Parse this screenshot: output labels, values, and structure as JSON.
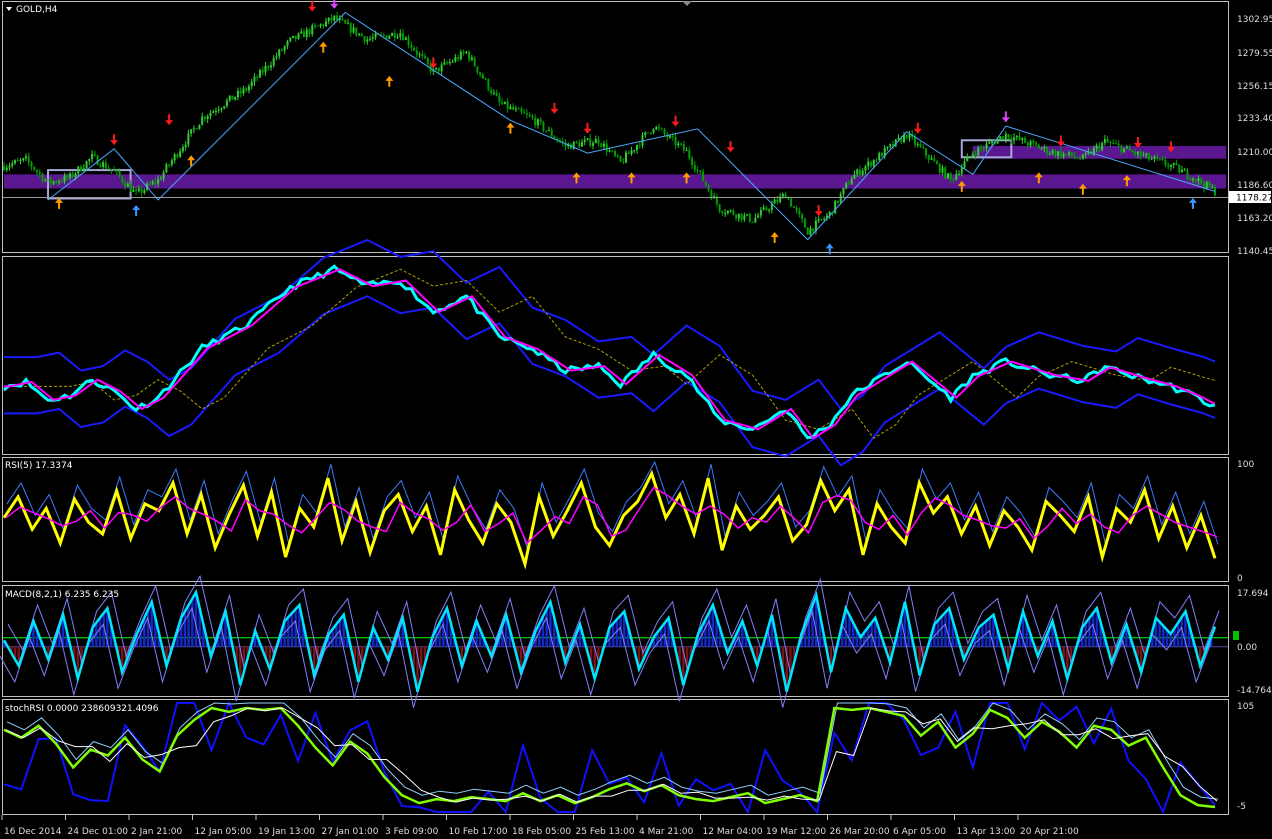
{
  "window": {
    "symbol_title": "GOLD,H4",
    "current_price": "1178.27"
  },
  "colors": {
    "background": "#000000",
    "frame": "#c0c0c0",
    "candle_up": "#32cd32",
    "candle_down": "#00a000",
    "zigzag": "#4aa8ff",
    "zone": "#5b178f",
    "arrow_down": "#ff1a1a",
    "arrow_up": "#ff9a00",
    "arrow_top": "#e040fb",
    "arrow_bottom": "#3399ff",
    "bollinger": "#1a1aff",
    "ma_fast": "#00ffff",
    "ma_mid": "#ff00ff",
    "rsi_main": "#ffff00",
    "rsi_signal": "#ff00ff",
    "macd_line": "#00e5ff",
    "macd_hist_pos": "#1428c8",
    "macd_hist_neg": "#7a1515",
    "stoch_fast": "#7fff00",
    "stoch_raw": "#1010ff",
    "level_line": "#00ff00"
  },
  "x_axis": {
    "labels": [
      "16 Dec 2014",
      "24 Dec 01:00",
      "2 Jan 21:00",
      "12 Jan 05:00",
      "19 Jan 13:00",
      "27 Jan 01:00",
      "3 Feb 09:00",
      "10 Feb 17:00",
      "18 Feb 05:00",
      "25 Feb 13:00",
      "4 Mar 21:00",
      "12 Mar 04:00",
      "19 Mar 12:00",
      "26 Mar 20:00",
      "6 Apr 05:00",
      "13 Apr 13:00",
      "20 Apr 21:00"
    ]
  },
  "price_panel": {
    "ticks": [
      "1302.95",
      "1279.55",
      "1256.15",
      "1233.40",
      "1210.00",
      "1186.60",
      "1163.20",
      "1140.45"
    ]
  },
  "rsi_panel": {
    "title": "RSI(5) 17.3374",
    "ticks": [
      "100",
      "0"
    ]
  },
  "macd_panel": {
    "title": "MACD(8,2,1) 6.235 6.235",
    "ticks": [
      "17.694",
      "0.00",
      "-14.764"
    ]
  },
  "stoch_panel": {
    "title": "stochRSI 0.0000 238609321.4096",
    "ticks": [
      "105",
      "-5"
    ]
  },
  "chart_data": {
    "type": "candlestick",
    "symbol": "GOLD",
    "timeframe": "H4",
    "price_ylim": [
      1136,
      1310
    ],
    "price_path": [
      [
        0,
        1196
      ],
      [
        4,
        1200
      ],
      [
        8,
        1184
      ],
      [
        12,
        1188
      ],
      [
        16,
        1202
      ],
      [
        20,
        1192
      ],
      [
        24,
        1176
      ],
      [
        28,
        1186
      ],
      [
        36,
        1230
      ],
      [
        44,
        1250
      ],
      [
        52,
        1284
      ],
      [
        60,
        1300
      ],
      [
        66,
        1285
      ],
      [
        72,
        1290
      ],
      [
        78,
        1262
      ],
      [
        84,
        1276
      ],
      [
        90,
        1240
      ],
      [
        96,
        1229
      ],
      [
        102,
        1210
      ],
      [
        108,
        1214
      ],
      [
        112,
        1198
      ],
      [
        118,
        1224
      ],
      [
        124,
        1206
      ],
      [
        130,
        1166
      ],
      [
        136,
        1158
      ],
      [
        142,
        1176
      ],
      [
        146,
        1150
      ],
      [
        150,
        1162
      ],
      [
        154,
        1188
      ],
      [
        164,
        1218
      ],
      [
        172,
        1186
      ],
      [
        176,
        1205
      ],
      [
        182,
        1218
      ],
      [
        186,
        1212
      ],
      [
        190,
        1206
      ],
      [
        196,
        1201
      ],
      [
        200,
        1213
      ],
      [
        206,
        1204
      ],
      [
        212,
        1196
      ],
      [
        216,
        1188
      ],
      [
        220,
        1178
      ]
    ],
    "zigzag_points": [
      [
        8,
        1172
      ],
      [
        20,
        1208
      ],
      [
        28,
        1172
      ],
      [
        62,
        1304
      ],
      [
        92,
        1228
      ],
      [
        106,
        1205
      ],
      [
        126,
        1222
      ],
      [
        146,
        1144
      ],
      [
        164,
        1220
      ],
      [
        176,
        1190
      ],
      [
        182,
        1224
      ],
      [
        220,
        1178
      ]
    ],
    "zones": [
      {
        "from": 0,
        "to": 222,
        "low": 1180,
        "high": 1190
      },
      {
        "from": 176,
        "to": 222,
        "low": 1201,
        "high": 1210
      }
    ],
    "boxes": [
      {
        "from": 8,
        "to": 23,
        "low": 1173,
        "high": 1193
      },
      {
        "from": 174,
        "to": 183,
        "low": 1202,
        "high": 1214
      }
    ],
    "signals_down": [
      [
        20,
        1212
      ],
      [
        30,
        1226
      ],
      [
        56,
        1306
      ],
      [
        78,
        1266
      ],
      [
        100,
        1234
      ],
      [
        106,
        1220
      ],
      [
        122,
        1225
      ],
      [
        132,
        1207
      ],
      [
        148,
        1162
      ],
      [
        166,
        1220
      ],
      [
        192,
        1211
      ],
      [
        206,
        1210
      ],
      [
        212,
        1207
      ]
    ],
    "signals_up": [
      [
        10,
        1172
      ],
      [
        34,
        1202
      ],
      [
        58,
        1282
      ],
      [
        70,
        1258
      ],
      [
        92,
        1225
      ],
      [
        104,
        1190
      ],
      [
        114,
        1190
      ],
      [
        124,
        1190
      ],
      [
        140,
        1148
      ],
      [
        174,
        1184
      ],
      [
        188,
        1190
      ],
      [
        196,
        1182
      ],
      [
        204,
        1188
      ]
    ],
    "signals_top": [
      [
        60,
        1308
      ],
      [
        182,
        1228
      ]
    ],
    "signals_bottom": [
      [
        24,
        1167
      ],
      [
        150,
        1140
      ],
      [
        216,
        1172
      ]
    ],
    "rsi": {
      "period": 5,
      "last": 17.3374,
      "ylim": [
        0,
        100
      ],
      "values": [
        52,
        70,
        42,
        60,
        30,
        68,
        48,
        38,
        75,
        34,
        64,
        58,
        82,
        38,
        72,
        26,
        55,
        80,
        36,
        74,
        18,
        60,
        44,
        86,
        32,
        66,
        22,
        58,
        72,
        40,
        62,
        20,
        76,
        50,
        30,
        64,
        48,
        12,
        70,
        36,
        58,
        82,
        44,
        28,
        54,
        66,
        90,
        52,
        72,
        38,
        86,
        24,
        62,
        42,
        54,
        70,
        32,
        46,
        84,
        58,
        76,
        20,
        64,
        44,
        30,
        82,
        56,
        70,
        38,
        62,
        28,
        58,
        44,
        24,
        66,
        54,
        40,
        70,
        18,
        60,
        48,
        76,
        34,
        62,
        26,
        54,
        17
      ]
    },
    "macd": {
      "params": "8,2,1",
      "last": 6.235,
      "signal": 6.235,
      "ylim": [
        -14.764,
        17.694
      ],
      "values": [
        2,
        -6,
        8,
        -4,
        10,
        -10,
        6,
        12,
        -8,
        4,
        14,
        -6,
        9,
        17,
        -3,
        11,
        -12,
        5,
        -7,
        8,
        13,
        -9,
        4,
        10,
        -11,
        6,
        -4,
        9,
        -14,
        3,
        12,
        -6,
        8,
        -3,
        10,
        -8,
        5,
        14,
        -5,
        7,
        -10,
        6,
        11,
        -7,
        3,
        9,
        -12,
        4,
        13,
        -2,
        8,
        -6,
        10,
        -14,
        4,
        16,
        -8,
        12,
        3,
        9,
        -5,
        14,
        -9,
        7,
        12,
        -4,
        6,
        10,
        -7,
        11,
        -3,
        8,
        -10,
        6,
        12,
        -5,
        7,
        -8,
        9,
        4,
        11,
        -6,
        6.235
      ]
    },
    "stochrsi": {
      "last": 0.0,
      "raw": 238609321.4096,
      "ylim": [
        -5,
        105
      ],
      "values": [
        78,
        70,
        82,
        64,
        40,
        58,
        52,
        70,
        48,
        36,
        72,
        88,
        100,
        96,
        100,
        98,
        100,
        82,
        60,
        42,
        66,
        54,
        30,
        12,
        4,
        8,
        6,
        10,
        8,
        6,
        14,
        6,
        12,
        4,
        10,
        18,
        24,
        16,
        22,
        12,
        8,
        6,
        10,
        14,
        4,
        8,
        12,
        6,
        100,
        98,
        100,
        96,
        92,
        72,
        86,
        60,
        74,
        98,
        90,
        70,
        86,
        76,
        60,
        82,
        78,
        62,
        70,
        40,
        12,
        2,
        0
      ]
    }
  }
}
